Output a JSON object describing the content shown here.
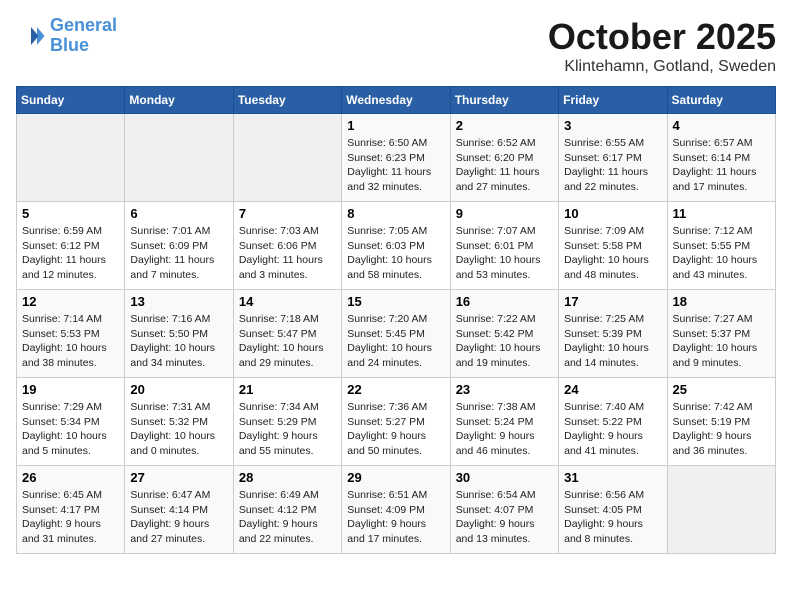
{
  "header": {
    "logo_line1": "General",
    "logo_line2": "Blue",
    "month": "October 2025",
    "location": "Klintehamn, Gotland, Sweden"
  },
  "weekdays": [
    "Sunday",
    "Monday",
    "Tuesday",
    "Wednesday",
    "Thursday",
    "Friday",
    "Saturday"
  ],
  "weeks": [
    [
      {
        "day": "",
        "text": ""
      },
      {
        "day": "",
        "text": ""
      },
      {
        "day": "",
        "text": ""
      },
      {
        "day": "1",
        "text": "Sunrise: 6:50 AM\nSunset: 6:23 PM\nDaylight: 11 hours\nand 32 minutes."
      },
      {
        "day": "2",
        "text": "Sunrise: 6:52 AM\nSunset: 6:20 PM\nDaylight: 11 hours\nand 27 minutes."
      },
      {
        "day": "3",
        "text": "Sunrise: 6:55 AM\nSunset: 6:17 PM\nDaylight: 11 hours\nand 22 minutes."
      },
      {
        "day": "4",
        "text": "Sunrise: 6:57 AM\nSunset: 6:14 PM\nDaylight: 11 hours\nand 17 minutes."
      }
    ],
    [
      {
        "day": "5",
        "text": "Sunrise: 6:59 AM\nSunset: 6:12 PM\nDaylight: 11 hours\nand 12 minutes."
      },
      {
        "day": "6",
        "text": "Sunrise: 7:01 AM\nSunset: 6:09 PM\nDaylight: 11 hours\nand 7 minutes."
      },
      {
        "day": "7",
        "text": "Sunrise: 7:03 AM\nSunset: 6:06 PM\nDaylight: 11 hours\nand 3 minutes."
      },
      {
        "day": "8",
        "text": "Sunrise: 7:05 AM\nSunset: 6:03 PM\nDaylight: 10 hours\nand 58 minutes."
      },
      {
        "day": "9",
        "text": "Sunrise: 7:07 AM\nSunset: 6:01 PM\nDaylight: 10 hours\nand 53 minutes."
      },
      {
        "day": "10",
        "text": "Sunrise: 7:09 AM\nSunset: 5:58 PM\nDaylight: 10 hours\nand 48 minutes."
      },
      {
        "day": "11",
        "text": "Sunrise: 7:12 AM\nSunset: 5:55 PM\nDaylight: 10 hours\nand 43 minutes."
      }
    ],
    [
      {
        "day": "12",
        "text": "Sunrise: 7:14 AM\nSunset: 5:53 PM\nDaylight: 10 hours\nand 38 minutes."
      },
      {
        "day": "13",
        "text": "Sunrise: 7:16 AM\nSunset: 5:50 PM\nDaylight: 10 hours\nand 34 minutes."
      },
      {
        "day": "14",
        "text": "Sunrise: 7:18 AM\nSunset: 5:47 PM\nDaylight: 10 hours\nand 29 minutes."
      },
      {
        "day": "15",
        "text": "Sunrise: 7:20 AM\nSunset: 5:45 PM\nDaylight: 10 hours\nand 24 minutes."
      },
      {
        "day": "16",
        "text": "Sunrise: 7:22 AM\nSunset: 5:42 PM\nDaylight: 10 hours\nand 19 minutes."
      },
      {
        "day": "17",
        "text": "Sunrise: 7:25 AM\nSunset: 5:39 PM\nDaylight: 10 hours\nand 14 minutes."
      },
      {
        "day": "18",
        "text": "Sunrise: 7:27 AM\nSunset: 5:37 PM\nDaylight: 10 hours\nand 9 minutes."
      }
    ],
    [
      {
        "day": "19",
        "text": "Sunrise: 7:29 AM\nSunset: 5:34 PM\nDaylight: 10 hours\nand 5 minutes."
      },
      {
        "day": "20",
        "text": "Sunrise: 7:31 AM\nSunset: 5:32 PM\nDaylight: 10 hours\nand 0 minutes."
      },
      {
        "day": "21",
        "text": "Sunrise: 7:34 AM\nSunset: 5:29 PM\nDaylight: 9 hours\nand 55 minutes."
      },
      {
        "day": "22",
        "text": "Sunrise: 7:36 AM\nSunset: 5:27 PM\nDaylight: 9 hours\nand 50 minutes."
      },
      {
        "day": "23",
        "text": "Sunrise: 7:38 AM\nSunset: 5:24 PM\nDaylight: 9 hours\nand 46 minutes."
      },
      {
        "day": "24",
        "text": "Sunrise: 7:40 AM\nSunset: 5:22 PM\nDaylight: 9 hours\nand 41 minutes."
      },
      {
        "day": "25",
        "text": "Sunrise: 7:42 AM\nSunset: 5:19 PM\nDaylight: 9 hours\nand 36 minutes."
      }
    ],
    [
      {
        "day": "26",
        "text": "Sunrise: 6:45 AM\nSunset: 4:17 PM\nDaylight: 9 hours\nand 31 minutes."
      },
      {
        "day": "27",
        "text": "Sunrise: 6:47 AM\nSunset: 4:14 PM\nDaylight: 9 hours\nand 27 minutes."
      },
      {
        "day": "28",
        "text": "Sunrise: 6:49 AM\nSunset: 4:12 PM\nDaylight: 9 hours\nand 22 minutes."
      },
      {
        "day": "29",
        "text": "Sunrise: 6:51 AM\nSunset: 4:09 PM\nDaylight: 9 hours\nand 17 minutes."
      },
      {
        "day": "30",
        "text": "Sunrise: 6:54 AM\nSunset: 4:07 PM\nDaylight: 9 hours\nand 13 minutes."
      },
      {
        "day": "31",
        "text": "Sunrise: 6:56 AM\nSunset: 4:05 PM\nDaylight: 9 hours\nand 8 minutes."
      },
      {
        "day": "",
        "text": ""
      }
    ]
  ]
}
